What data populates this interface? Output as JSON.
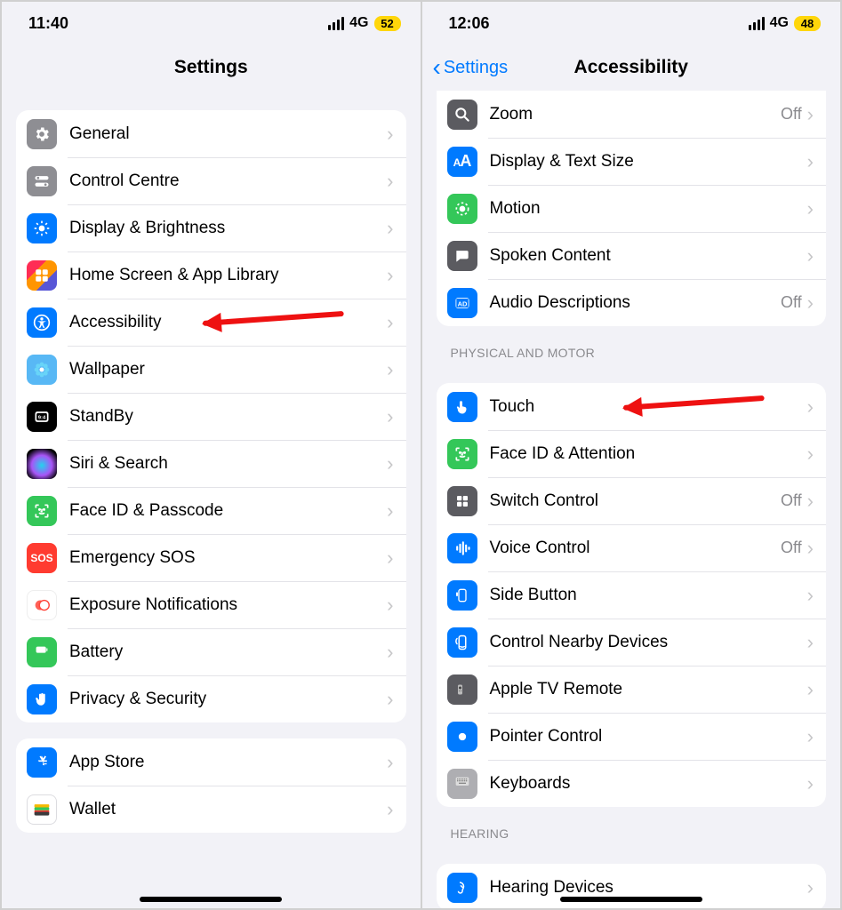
{
  "left": {
    "status": {
      "time": "11:40",
      "network": "4G",
      "battery": "52"
    },
    "title": "Settings",
    "groups": [
      [
        {
          "label": "General",
          "icon": "gear-icon",
          "bg": "bg-gray"
        },
        {
          "label": "Control Centre",
          "icon": "switches-icon",
          "bg": "bg-gray"
        },
        {
          "label": "Display & Brightness",
          "icon": "brightness-icon",
          "bg": "bg-blue"
        },
        {
          "label": "Home Screen & App Library",
          "icon": "home-grid-icon",
          "bg": "bg-multi"
        },
        {
          "label": "Accessibility",
          "icon": "accessibility-icon",
          "bg": "bg-blue",
          "arrow": true
        },
        {
          "label": "Wallpaper",
          "icon": "flower-icon",
          "bg": "bg-blue",
          "lighten": true
        },
        {
          "label": "StandBy",
          "icon": "clock-icon",
          "bg": "bg-black"
        },
        {
          "label": "Siri & Search",
          "icon": "siri-icon",
          "bg": "bg-siri"
        },
        {
          "label": "Face ID & Passcode",
          "icon": "faceid-icon",
          "bg": "bg-green"
        },
        {
          "label": "Emergency SOS",
          "icon": "sos-icon",
          "bg": "bg-red"
        },
        {
          "label": "Exposure Notifications",
          "icon": "exposure-icon",
          "bg": "bg-exposure"
        },
        {
          "label": "Battery",
          "icon": "battery-icon",
          "bg": "bg-green"
        },
        {
          "label": "Privacy & Security",
          "icon": "hand-icon",
          "bg": "bg-blue"
        }
      ],
      [
        {
          "label": "App Store",
          "icon": "appstore-icon",
          "bg": "bg-blue"
        },
        {
          "label": "Wallet",
          "icon": "wallet-icon",
          "bg": "bg-white"
        }
      ]
    ]
  },
  "right": {
    "status": {
      "time": "12:06",
      "network": "4G",
      "battery": "48"
    },
    "back": "Settings",
    "title": "Accessibility",
    "groups": [
      {
        "header": null,
        "rows": [
          {
            "label": "Zoom",
            "icon": "zoom-icon",
            "bg": "bg-darkgray",
            "value": "Off"
          },
          {
            "label": "Display & Text Size",
            "icon": "textsize-icon",
            "bg": "bg-blue"
          },
          {
            "label": "Motion",
            "icon": "motion-icon",
            "bg": "bg-green"
          },
          {
            "label": "Spoken Content",
            "icon": "speech-icon",
            "bg": "bg-darkgray"
          },
          {
            "label": "Audio Descriptions",
            "icon": "caption-icon",
            "bg": "bg-blue",
            "value": "Off"
          }
        ]
      },
      {
        "header": "PHYSICAL AND MOTOR",
        "rows": [
          {
            "label": "Touch",
            "icon": "touch-icon",
            "bg": "bg-blue",
            "arrow": true
          },
          {
            "label": "Face ID & Attention",
            "icon": "faceid-icon",
            "bg": "bg-green"
          },
          {
            "label": "Switch Control",
            "icon": "switch-ctl-icon",
            "bg": "bg-darkgray",
            "value": "Off"
          },
          {
            "label": "Voice Control",
            "icon": "voice-ctl-icon",
            "bg": "bg-blue",
            "value": "Off"
          },
          {
            "label": "Side Button",
            "icon": "side-btn-icon",
            "bg": "bg-blue"
          },
          {
            "label": "Control Nearby Devices",
            "icon": "nearby-icon",
            "bg": "bg-blue"
          },
          {
            "label": "Apple TV Remote",
            "icon": "remote-icon",
            "bg": "bg-darkgray"
          },
          {
            "label": "Pointer Control",
            "icon": "pointer-icon",
            "bg": "bg-blue"
          },
          {
            "label": "Keyboards",
            "icon": "keyboard-icon",
            "bg": "bg-lgray"
          }
        ]
      },
      {
        "header": "HEARING",
        "rows": [
          {
            "label": "Hearing Devices",
            "icon": "ear-icon",
            "bg": "bg-blue"
          }
        ]
      }
    ]
  }
}
